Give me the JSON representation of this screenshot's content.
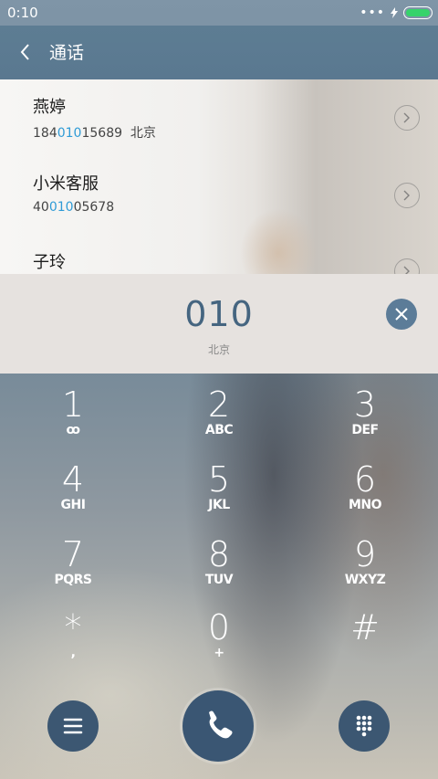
{
  "status": {
    "time": "0:10"
  },
  "header": {
    "title": "通话"
  },
  "contacts": [
    {
      "name": "燕婷",
      "num_pre": "184",
      "num_hl": "010",
      "num_post": "15689",
      "location": "北京"
    },
    {
      "name": "小米客服",
      "num_pre": "40",
      "num_hl": "010",
      "num_post": "05678",
      "location": ""
    },
    {
      "name": "子玲",
      "num_pre": "",
      "num_hl": "",
      "num_post": "",
      "location": ""
    }
  ],
  "dial": {
    "digits": "010",
    "location": "北京"
  },
  "keypad": [
    {
      "n": "1",
      "l": "ꝏ"
    },
    {
      "n": "2",
      "l": "ABC"
    },
    {
      "n": "3",
      "l": "DEF"
    },
    {
      "n": "4",
      "l": "GHI"
    },
    {
      "n": "5",
      "l": "JKL"
    },
    {
      "n": "6",
      "l": "MNO"
    },
    {
      "n": "7",
      "l": "PQRS"
    },
    {
      "n": "8",
      "l": "TUV"
    },
    {
      "n": "9",
      "l": "WXYZ"
    },
    {
      "n": "*",
      "l": ","
    },
    {
      "n": "0",
      "l": "+"
    },
    {
      "n": "#",
      "l": ""
    }
  ],
  "icons": {
    "back": "back-arrow-icon",
    "clear": "clear-icon",
    "menu": "menu-icon",
    "call": "phone-icon",
    "keypad": "keypad-icon"
  }
}
